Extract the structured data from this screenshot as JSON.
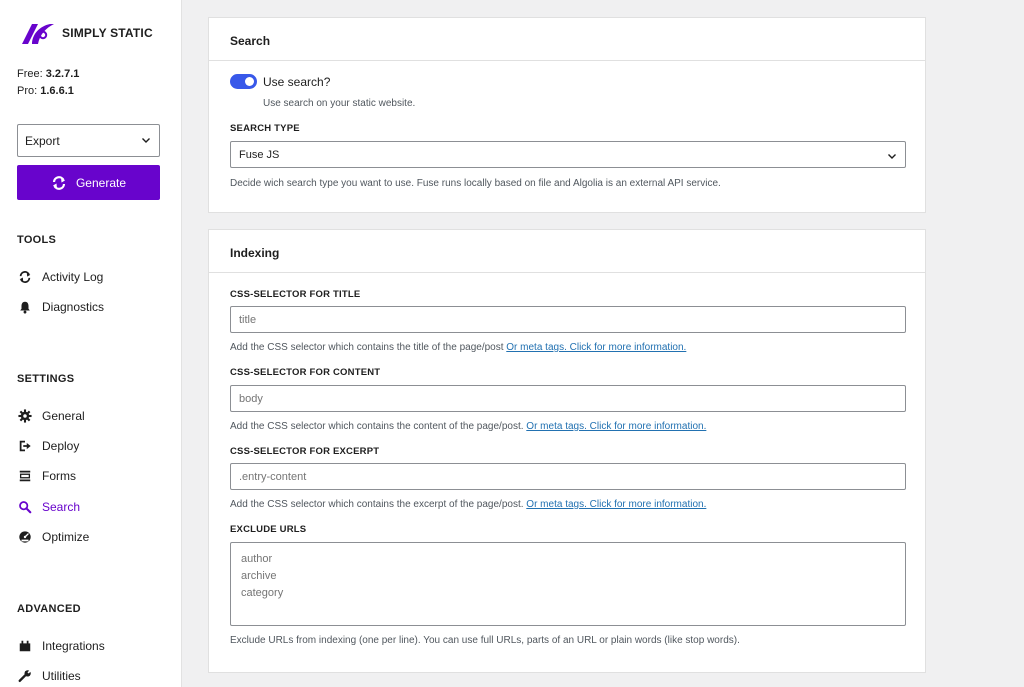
{
  "brand": {
    "name": "SIMPLY STATIC"
  },
  "versions": {
    "free_label": "Free:",
    "free_value": "3.2.7.1",
    "pro_label": "Pro:",
    "pro_value": "1.6.6.1"
  },
  "action_select": {
    "value": "Export"
  },
  "generate_button": {
    "label": "Generate"
  },
  "sidebar": {
    "tools_title": "TOOLS",
    "tools": [
      {
        "label": "Activity Log",
        "icon": "refresh-icon"
      },
      {
        "label": "Diagnostics",
        "icon": "bell-icon"
      }
    ],
    "settings_title": "SETTINGS",
    "settings": [
      {
        "label": "General",
        "icon": "gear-icon"
      },
      {
        "label": "Deploy",
        "icon": "deploy-icon"
      },
      {
        "label": "Forms",
        "icon": "forms-icon"
      },
      {
        "label": "Search",
        "icon": "search-icon",
        "active": true
      },
      {
        "label": "Optimize",
        "icon": "gauge-icon"
      }
    ],
    "advanced_title": "ADVANCED",
    "advanced": [
      {
        "label": "Integrations",
        "icon": "integrations-icon"
      },
      {
        "label": "Utilities",
        "icon": "wrench-icon"
      }
    ]
  },
  "search_card": {
    "title": "Search",
    "toggle_label": "Use search?",
    "toggle_on": true,
    "toggle_help": "Use search on your static website.",
    "search_type_label": "SEARCH TYPE",
    "search_type_value": "Fuse JS",
    "search_type_help": "Decide wich search type you want to use. Fuse runs locally based on file and Algolia is an external API service."
  },
  "indexing_card": {
    "title": "Indexing",
    "title_selector": {
      "label": "CSS-SELECTOR FOR TITLE",
      "placeholder": "title",
      "help": "Add the CSS selector which contains the title of the page/post",
      "link": "Or meta tags. Click for more information."
    },
    "content_selector": {
      "label": "CSS-SELECTOR FOR CONTENT",
      "placeholder": "body",
      "help": "Add the CSS selector which contains the content of the page/post.",
      "link": "Or meta tags. Click for more information."
    },
    "excerpt_selector": {
      "label": "CSS-SELECTOR FOR EXCERPT",
      "placeholder": ".entry-content",
      "help": "Add the CSS selector which contains the excerpt of the page/post.",
      "link": "Or meta tags. Click for more information."
    },
    "exclude_urls": {
      "label": "EXCLUDE URLS",
      "placeholder": "author\narchive\ncategory",
      "help": "Exclude URLs from indexing (one per line). You can use full URLs, parts of an URL or plain words (like stop words)."
    }
  },
  "colors": {
    "brand_purple": "#6804cc",
    "toggle_blue": "#3858e9",
    "link_blue": "#2271b1"
  }
}
